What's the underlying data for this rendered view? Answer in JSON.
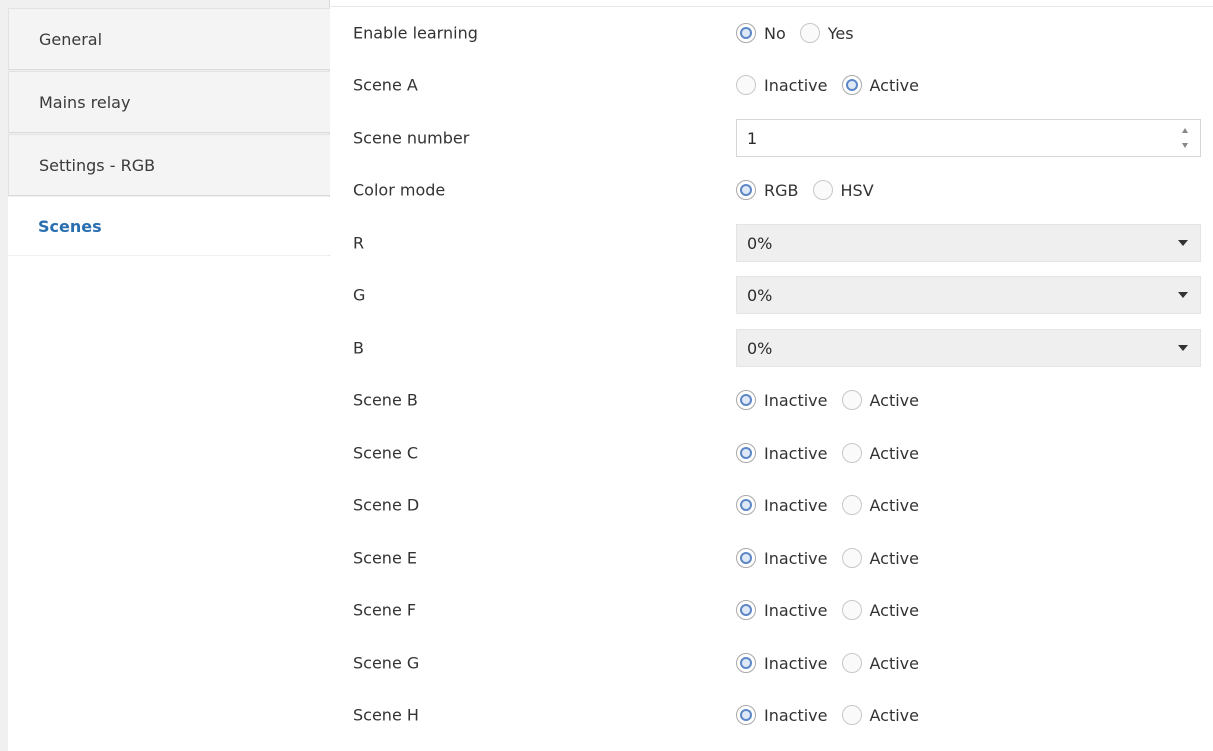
{
  "sidebar": {
    "items": [
      {
        "label": "General",
        "active": false
      },
      {
        "label": "Mains relay",
        "active": false
      },
      {
        "label": "Settings - RGB",
        "active": false
      },
      {
        "label": "Scenes",
        "active": true
      }
    ]
  },
  "form": {
    "enable_learning": {
      "label": "Enable learning",
      "options": [
        "No",
        "Yes"
      ],
      "selected": "No"
    },
    "scene_a": {
      "label": "Scene A",
      "options": [
        "Inactive",
        "Active"
      ],
      "selected": "Active"
    },
    "scene_number": {
      "label": "Scene number",
      "value": "1"
    },
    "color_mode": {
      "label": "Color mode",
      "options": [
        "RGB",
        "HSV"
      ],
      "selected": "RGB"
    },
    "r": {
      "label": "R",
      "value": "0%"
    },
    "g": {
      "label": "G",
      "value": "0%"
    },
    "b": {
      "label": "B",
      "value": "0%"
    },
    "scene_b": {
      "label": "Scene B",
      "options": [
        "Inactive",
        "Active"
      ],
      "selected": "Inactive"
    },
    "scene_c": {
      "label": "Scene C",
      "options": [
        "Inactive",
        "Active"
      ],
      "selected": "Inactive"
    },
    "scene_d": {
      "label": "Scene D",
      "options": [
        "Inactive",
        "Active"
      ],
      "selected": "Inactive"
    },
    "scene_e": {
      "label": "Scene E",
      "options": [
        "Inactive",
        "Active"
      ],
      "selected": "Inactive"
    },
    "scene_f": {
      "label": "Scene F",
      "options": [
        "Inactive",
        "Active"
      ],
      "selected": "Inactive"
    },
    "scene_g": {
      "label": "Scene G",
      "options": [
        "Inactive",
        "Active"
      ],
      "selected": "Inactive"
    },
    "scene_h": {
      "label": "Scene H",
      "options": [
        "Inactive",
        "Active"
      ],
      "selected": "Inactive"
    }
  },
  "colors": {
    "accent": "#2a6fb0",
    "radio_dot": "#5b86c8"
  }
}
